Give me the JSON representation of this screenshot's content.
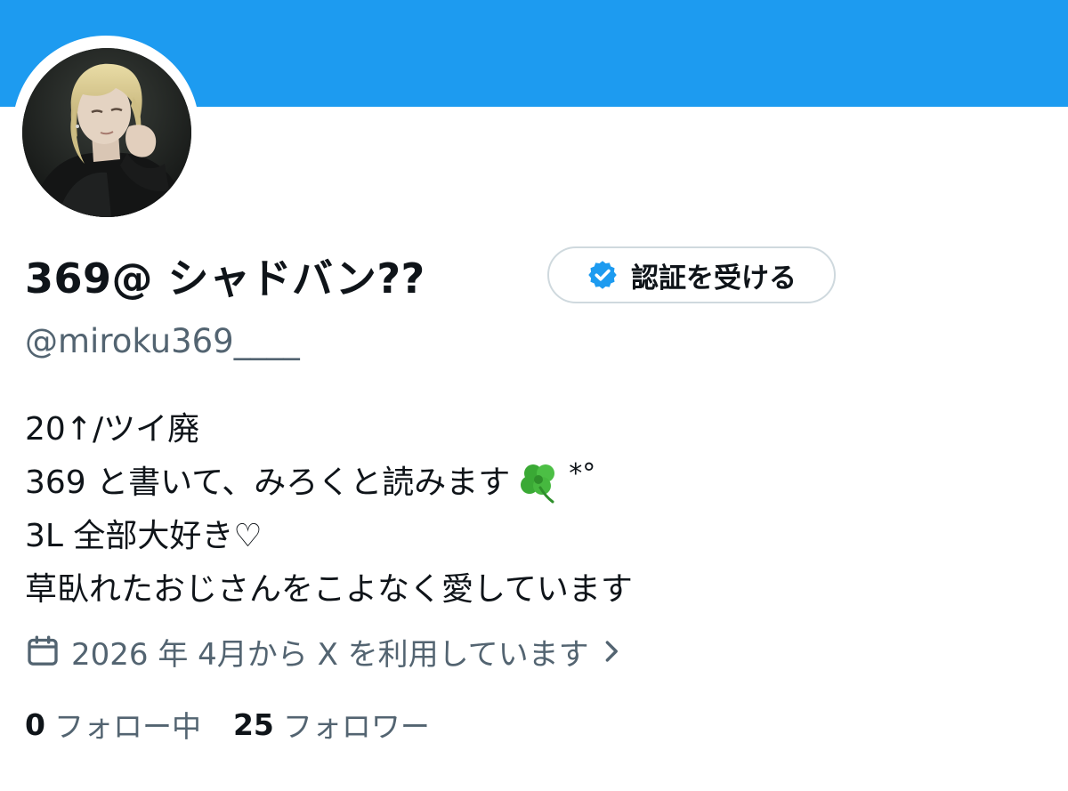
{
  "profile": {
    "display_name": "369@ シャドバン??",
    "handle": "@miroku369____",
    "verify_button_label": "認証を受ける",
    "bio_lines": [
      "20↑/ツイ廃",
      "369 と書いて、みろくと読みます",
      "3L 全部大好き♡",
      "草臥れたおじさんをこよなく愛しています"
    ],
    "bio_line2_suffix": "*°",
    "joined_text": "2026 年 4月から X を利用しています",
    "following_count": "0",
    "following_label": "フォロー中",
    "followers_count": "25",
    "followers_label": "フォロワー"
  },
  "colors": {
    "banner": "#1d9bf0",
    "secondary_text": "#536471",
    "primary_text": "#0f1419",
    "verify_badge": "#1d9bf0"
  },
  "icons": {
    "verify_badge": "verified-badge-icon",
    "calendar": "calendar-icon",
    "chevron": "chevron-right-icon",
    "clover": "four-leaf-clover-icon"
  }
}
